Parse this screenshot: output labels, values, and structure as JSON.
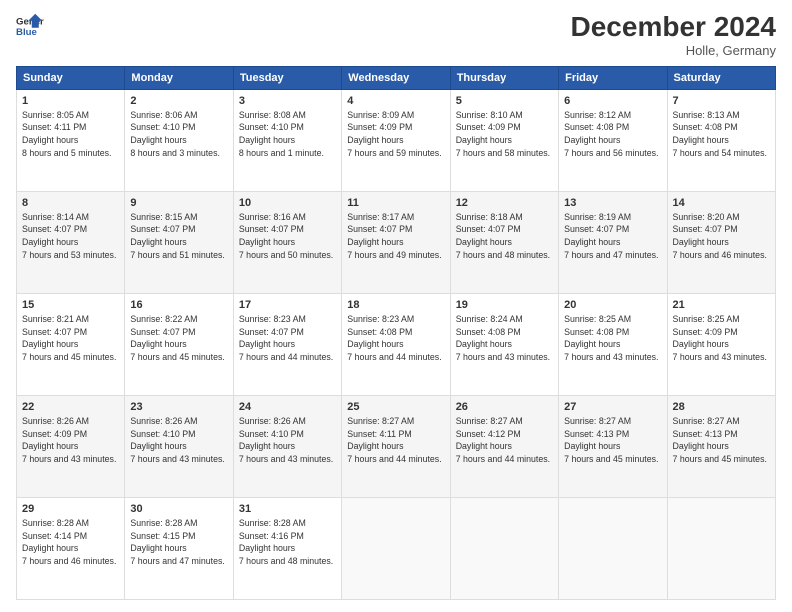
{
  "header": {
    "logo_line1": "General",
    "logo_line2": "Blue",
    "month": "December 2024",
    "location": "Holle, Germany"
  },
  "weekdays": [
    "Sunday",
    "Monday",
    "Tuesday",
    "Wednesday",
    "Thursday",
    "Friday",
    "Saturday"
  ],
  "weeks": [
    [
      {
        "day": "1",
        "sunrise": "8:05 AM",
        "sunset": "4:11 PM",
        "daylight": "8 hours and 5 minutes."
      },
      {
        "day": "2",
        "sunrise": "8:06 AM",
        "sunset": "4:10 PM",
        "daylight": "8 hours and 3 minutes."
      },
      {
        "day": "3",
        "sunrise": "8:08 AM",
        "sunset": "4:10 PM",
        "daylight": "8 hours and 1 minute."
      },
      {
        "day": "4",
        "sunrise": "8:09 AM",
        "sunset": "4:09 PM",
        "daylight": "7 hours and 59 minutes."
      },
      {
        "day": "5",
        "sunrise": "8:10 AM",
        "sunset": "4:09 PM",
        "daylight": "7 hours and 58 minutes."
      },
      {
        "day": "6",
        "sunrise": "8:12 AM",
        "sunset": "4:08 PM",
        "daylight": "7 hours and 56 minutes."
      },
      {
        "day": "7",
        "sunrise": "8:13 AM",
        "sunset": "4:08 PM",
        "daylight": "7 hours and 54 minutes."
      }
    ],
    [
      {
        "day": "8",
        "sunrise": "8:14 AM",
        "sunset": "4:07 PM",
        "daylight": "7 hours and 53 minutes."
      },
      {
        "day": "9",
        "sunrise": "8:15 AM",
        "sunset": "4:07 PM",
        "daylight": "7 hours and 51 minutes."
      },
      {
        "day": "10",
        "sunrise": "8:16 AM",
        "sunset": "4:07 PM",
        "daylight": "7 hours and 50 minutes."
      },
      {
        "day": "11",
        "sunrise": "8:17 AM",
        "sunset": "4:07 PM",
        "daylight": "7 hours and 49 minutes."
      },
      {
        "day": "12",
        "sunrise": "8:18 AM",
        "sunset": "4:07 PM",
        "daylight": "7 hours and 48 minutes."
      },
      {
        "day": "13",
        "sunrise": "8:19 AM",
        "sunset": "4:07 PM",
        "daylight": "7 hours and 47 minutes."
      },
      {
        "day": "14",
        "sunrise": "8:20 AM",
        "sunset": "4:07 PM",
        "daylight": "7 hours and 46 minutes."
      }
    ],
    [
      {
        "day": "15",
        "sunrise": "8:21 AM",
        "sunset": "4:07 PM",
        "daylight": "7 hours and 45 minutes."
      },
      {
        "day": "16",
        "sunrise": "8:22 AM",
        "sunset": "4:07 PM",
        "daylight": "7 hours and 45 minutes."
      },
      {
        "day": "17",
        "sunrise": "8:23 AM",
        "sunset": "4:07 PM",
        "daylight": "7 hours and 44 minutes."
      },
      {
        "day": "18",
        "sunrise": "8:23 AM",
        "sunset": "4:08 PM",
        "daylight": "7 hours and 44 minutes."
      },
      {
        "day": "19",
        "sunrise": "8:24 AM",
        "sunset": "4:08 PM",
        "daylight": "7 hours and 43 minutes."
      },
      {
        "day": "20",
        "sunrise": "8:25 AM",
        "sunset": "4:08 PM",
        "daylight": "7 hours and 43 minutes."
      },
      {
        "day": "21",
        "sunrise": "8:25 AM",
        "sunset": "4:09 PM",
        "daylight": "7 hours and 43 minutes."
      }
    ],
    [
      {
        "day": "22",
        "sunrise": "8:26 AM",
        "sunset": "4:09 PM",
        "daylight": "7 hours and 43 minutes."
      },
      {
        "day": "23",
        "sunrise": "8:26 AM",
        "sunset": "4:10 PM",
        "daylight": "7 hours and 43 minutes."
      },
      {
        "day": "24",
        "sunrise": "8:26 AM",
        "sunset": "4:10 PM",
        "daylight": "7 hours and 43 minutes."
      },
      {
        "day": "25",
        "sunrise": "8:27 AM",
        "sunset": "4:11 PM",
        "daylight": "7 hours and 44 minutes."
      },
      {
        "day": "26",
        "sunrise": "8:27 AM",
        "sunset": "4:12 PM",
        "daylight": "7 hours and 44 minutes."
      },
      {
        "day": "27",
        "sunrise": "8:27 AM",
        "sunset": "4:13 PM",
        "daylight": "7 hours and 45 minutes."
      },
      {
        "day": "28",
        "sunrise": "8:27 AM",
        "sunset": "4:13 PM",
        "daylight": "7 hours and 45 minutes."
      }
    ],
    [
      {
        "day": "29",
        "sunrise": "8:28 AM",
        "sunset": "4:14 PM",
        "daylight": "7 hours and 46 minutes."
      },
      {
        "day": "30",
        "sunrise": "8:28 AM",
        "sunset": "4:15 PM",
        "daylight": "7 hours and 47 minutes."
      },
      {
        "day": "31",
        "sunrise": "8:28 AM",
        "sunset": "4:16 PM",
        "daylight": "7 hours and 48 minutes."
      },
      null,
      null,
      null,
      null
    ]
  ]
}
